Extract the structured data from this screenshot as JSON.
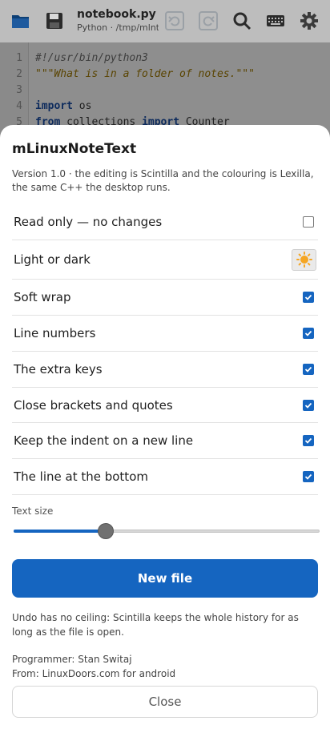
{
  "toolbar": {
    "file_name": "notebook.py",
    "file_path": "Python · /tmp/mlnt",
    "icons": [
      "folder-icon",
      "save-icon",
      "undo-icon",
      "redo-icon",
      "search-icon",
      "keyboard-icon",
      "gear-icon"
    ]
  },
  "editor": {
    "line_numbers": [
      "1",
      "2",
      "3",
      "4",
      "5"
    ],
    "lines": {
      "l1": "#!/usr/bin/python3",
      "l2": "\"\"\"What is in a folder of notes.\"\"\"",
      "l4_kw": "import",
      "l4_rest": " os",
      "l5_kw1": "from",
      "l5_mid": " collections ",
      "l5_kw2": "import",
      "l5_rest": " Counter"
    }
  },
  "sheet": {
    "title": "mLinuxNoteText",
    "info": "Version 1.0  ·  the editing is Scintilla and the colouring is Lexilla, the same C++ the desktop runs.",
    "options": [
      {
        "label": "Read only — no changes",
        "checked": false
      },
      {
        "label": "Light or dark",
        "control": "sun-icon"
      },
      {
        "label": "Soft wrap",
        "checked": true
      },
      {
        "label": "Line numbers",
        "checked": true
      },
      {
        "label": "The extra keys",
        "checked": true
      },
      {
        "label": "Close brackets and quotes",
        "checked": true
      },
      {
        "label": "Keep the indent on a new line",
        "checked": true
      },
      {
        "label": "The line at the bottom",
        "checked": true
      }
    ],
    "text_size_label": "Text size",
    "text_size_fraction": 0.3,
    "new_file_label": "New file",
    "undo_note": "Undo has no ceiling: Scintilla keeps the whole history for as long as the file is open.",
    "programmer": "Programmer: Stan Switaj",
    "from": "From: LinuxDoors.com for android",
    "close_label": "Close"
  },
  "colors": {
    "accent": "#1565c0",
    "sun": "#f5a623"
  }
}
